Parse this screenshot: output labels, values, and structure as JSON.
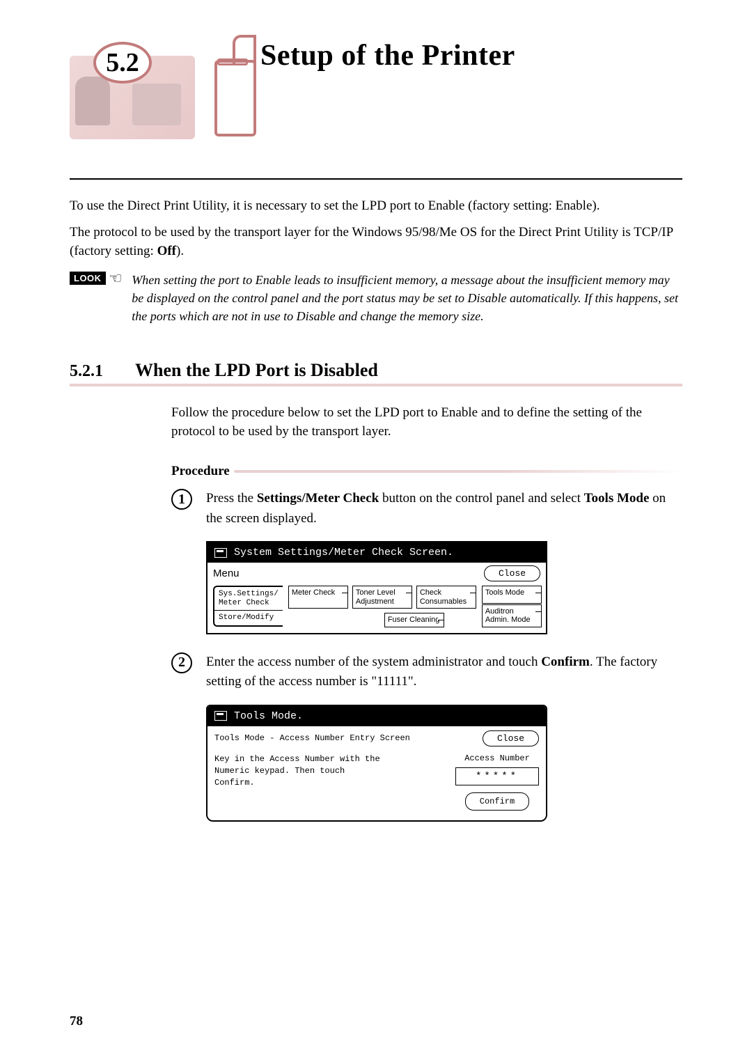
{
  "header": {
    "section_number": "5.2",
    "title": "Setup of the Printer"
  },
  "intro": {
    "p1": "To use the Direct Print Utility, it is necessary to set the LPD port to Enable (factory setting: Enable).",
    "p2_a": "The protocol to be used by the transport layer for the Windows 95/98/Me OS for the Direct Print Utility is TCP/IP (factory setting: ",
    "p2_bold": "Off",
    "p2_b": ")."
  },
  "look": {
    "tag": "LOOK",
    "note": "When setting the port to Enable leads to insufficient memory, a message about the insufficient memory may be displayed on the control panel and the port status may be set to Disable automatically. If this happens, set the ports which are not in use to Disable and change the memory size."
  },
  "section": {
    "num": "5.2.1",
    "title": "When the LPD Port is Disabled",
    "lead": "Follow the procedure below to set the LPD port to Enable and to define the setting of the protocol to be used by the transport layer.",
    "procedure_label": "Procedure"
  },
  "step1": {
    "num": "1",
    "t1": "Press the ",
    "b1": "Settings/Meter Check",
    "t2": " button on the control panel and select ",
    "b2": "Tools Mode",
    "t3": " on the screen displayed."
  },
  "panel1": {
    "title": "System Settings/Meter Check Screen.",
    "menu": "Menu",
    "close": "Close",
    "left1": "Sys.Settings/\nMeter Check",
    "left2": "Store/Modify",
    "meter": "Meter Check",
    "toner": "Toner Level Adjustment",
    "check": "Check Consumables",
    "fuser": "Fuser Cleaning",
    "tools": "Tools Mode",
    "auditron": "Auditron Admin. Mode"
  },
  "step2": {
    "num": "2",
    "t1": "Enter the access number of the system administrator and touch ",
    "b1": "Confirm",
    "t2": ". The factory setting of the access number is \"11111\"."
  },
  "panel2": {
    "title": "Tools Mode.",
    "sub": "Tools Mode - Access Number Entry Screen",
    "close": "Close",
    "msg": "Key in the Access Number with the Numeric keypad. Then touch Confirm.",
    "acc_label": "Access Number",
    "acc_value": "*****",
    "confirm": "Confirm"
  },
  "page_number": "78"
}
